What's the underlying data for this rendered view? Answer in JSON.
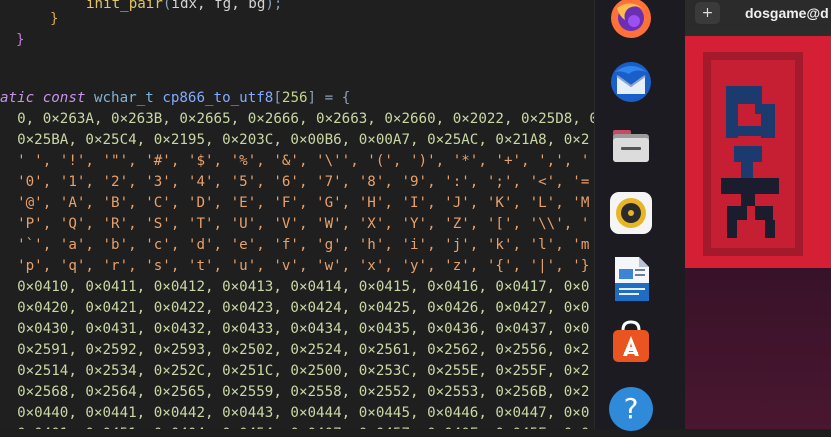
{
  "editor": {
    "lines": [
      {
        "parts": [
          {
            "c": "fn",
            "t": "init_pair"
          },
          {
            "c": "punc",
            "t": "("
          },
          {
            "c": "op",
            "t": "idx, fg, bg"
          },
          {
            "c": "punc",
            "t": ");"
          }
        ]
      },
      {
        "parts": [
          {
            "c": "brace",
            "t": "}"
          }
        ]
      },
      {
        "parts": [
          {
            "c": "brace2",
            "t": "}"
          }
        ]
      },
      {
        "parts": []
      },
      {
        "parts": [
          {
            "c": "kw",
            "t": "atic const "
          },
          {
            "c": "type",
            "t": "wchar_t "
          },
          {
            "c": "ident",
            "t": "cp866_to_utf8"
          },
          {
            "c": "punc",
            "t": "["
          },
          {
            "c": "num",
            "t": "256"
          },
          {
            "c": "punc",
            "t": "] = {"
          }
        ]
      },
      {
        "parts": [
          {
            "c": "hex",
            "t": "  0, 0×263A, 0×263B, 0×2665, 0×2666, 0×2663, 0×2660, 0×2022, 0×25D8, 0×"
          }
        ]
      },
      {
        "parts": [
          {
            "c": "hex",
            "t": "  0×25BA, 0×25C4, 0×2195, 0×203C, 0×00B6, 0×00A7, 0×25AC, 0×21A8, 0×2"
          }
        ]
      },
      {
        "parts": [
          {
            "c": "chr",
            "t": "  ' ', '!', '\"', '#', '$', '%', '&', '\\'', '(', ')', '*', '+', ',', '"
          }
        ]
      },
      {
        "parts": [
          {
            "c": "chr",
            "t": "  '0', '1', '2', '3', '4', '5', '6', '7', '8', '9', ':', ';', '<', '="
          }
        ]
      },
      {
        "parts": [
          {
            "c": "chr",
            "t": "  '@', 'A', 'B', 'C', 'D', 'E', 'F', 'G', 'H', 'I', 'J', 'K', 'L', 'M"
          }
        ]
      },
      {
        "parts": [
          {
            "c": "chr",
            "t": "  'P', 'Q', 'R', 'S', 'T', 'U', 'V', 'W', 'X', 'Y', 'Z', '[', '\\\\', '"
          }
        ]
      },
      {
        "parts": [
          {
            "c": "chr",
            "t": "  '`', 'a', 'b', 'c', 'd', 'e', 'f', 'g', 'h', 'i', 'j', 'k', 'l', 'm"
          }
        ]
      },
      {
        "parts": [
          {
            "c": "chr",
            "t": "  'p', 'q', 'r', 's', 't', 'u', 'v', 'w', 'x', 'y', 'z', '{', '|', '}"
          }
        ]
      },
      {
        "parts": [
          {
            "c": "hex",
            "t": "  0×0410, 0×0411, 0×0412, 0×0413, 0×0414, 0×0415, 0×0416, 0×0417, 0×0"
          }
        ]
      },
      {
        "parts": [
          {
            "c": "hex",
            "t": "  0×0420, 0×0421, 0×0422, 0×0423, 0×0424, 0×0425, 0×0426, 0×0427, 0×0"
          }
        ]
      },
      {
        "parts": [
          {
            "c": "hex",
            "t": "  0×0430, 0×0431, 0×0432, 0×0433, 0×0434, 0×0435, 0×0436, 0×0437, 0×0"
          }
        ]
      },
      {
        "parts": [
          {
            "c": "hex",
            "t": "  0×2591, 0×2592, 0×2593, 0×2502, 0×2524, 0×2561, 0×2562, 0×2556, 0×2"
          }
        ]
      },
      {
        "parts": [
          {
            "c": "hex",
            "t": "  0×2514, 0×2534, 0×252C, 0×251C, 0×2500, 0×253C, 0×255E, 0×255F, 0×2"
          }
        ]
      },
      {
        "parts": [
          {
            "c": "hex",
            "t": "  0×2568, 0×2564, 0×2565, 0×2559, 0×2558, 0×2552, 0×2553, 0×256B, 0×2"
          }
        ]
      },
      {
        "parts": [
          {
            "c": "hex",
            "t": "  0×0440, 0×0441, 0×0442, 0×0443, 0×0444, 0×0445, 0×0446, 0×0447, 0×0"
          }
        ]
      },
      {
        "parts": [
          {
            "c": "hex",
            "t": "  0×0401, 0×0451, 0×0404, 0×0454, 0×0407, 0×0457, 0×040E, 0×045E, 0×0"
          }
        ]
      }
    ]
  },
  "dock": {
    "items": [
      {
        "name": "firefox-icon",
        "label": ""
      },
      {
        "name": "thunderbird-icon",
        "label": ""
      },
      {
        "name": "files-icon",
        "label": ""
      },
      {
        "name": "rhythmbox-icon",
        "label": ""
      },
      {
        "name": "writer-icon",
        "label": ""
      },
      {
        "name": "app-center-icon",
        "label": ""
      },
      {
        "name": "help-icon",
        "label": "?"
      }
    ]
  },
  "window": {
    "new_tab_label": "+",
    "title": "dosgame@d"
  },
  "colors": {
    "game_bg": "#d41f35",
    "game_dark": "#1b1d2e",
    "game_blue": "#1d3a6e"
  }
}
